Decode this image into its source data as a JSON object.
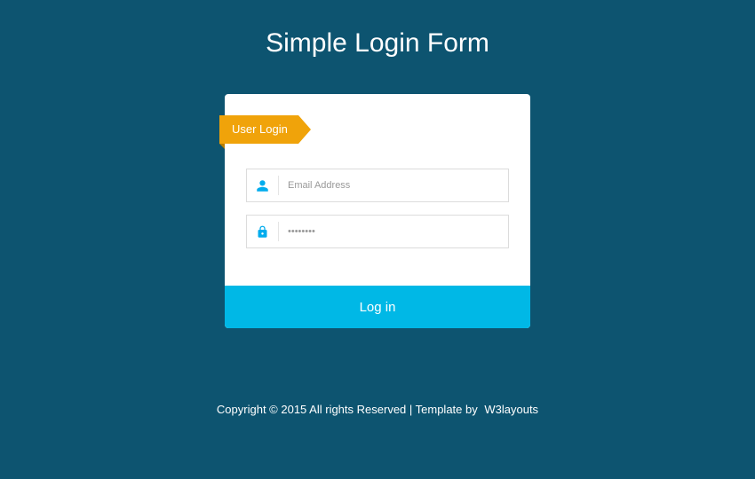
{
  "page": {
    "title": "Simple Login Form"
  },
  "ribbon": {
    "label": "User Login"
  },
  "form": {
    "email": {
      "placeholder": "Email Address",
      "value": ""
    },
    "password": {
      "placeholder": "••••••••",
      "value": ""
    },
    "submit_label": "Log in"
  },
  "footer": {
    "copyright": "Copyright © 2015 All rights Reserved | Template by",
    "link_label": "W3layouts"
  }
}
